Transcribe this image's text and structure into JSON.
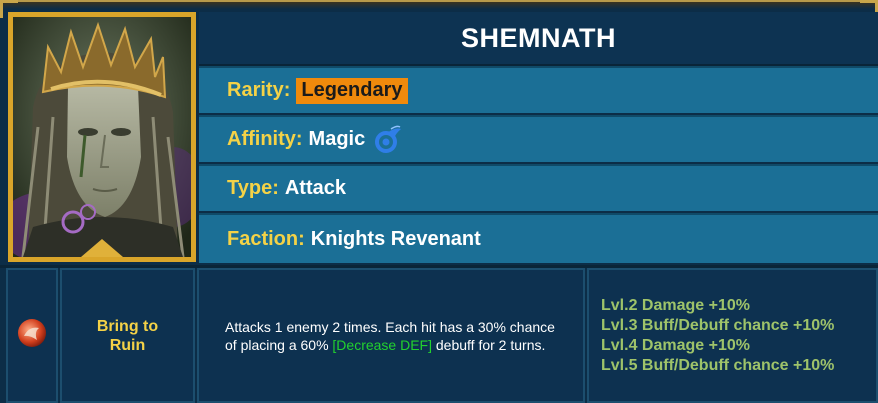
{
  "champion": {
    "name": "SHEMNATH",
    "rarity_label": "Rarity:",
    "rarity": "Legendary",
    "affinity_label": "Affinity:",
    "affinity": "Magic",
    "affinity_icon": "magic-affinity-icon",
    "type_label": "Type:",
    "type": "Attack",
    "faction_label": "Faction:",
    "faction": "Knights Revenant"
  },
  "skill": {
    "icon": "skill-icon",
    "name": "Bring to Ruin",
    "desc_before": "Attacks 1 enemy 2 times. Each hit has a 30% chance of placing a 60% ",
    "desc_debuff": "[Decrease DEF]",
    "desc_after": " debuff for 2 turns.",
    "books": [
      "Lvl.2 Damage +10%",
      "Lvl.3 Buff/Debuff chance +10%",
      "Lvl.4 Damage +10%",
      "Lvl.5 Buff/Debuff chance +10%"
    ]
  },
  "colors": {
    "rarity_badge": "#f08a0c",
    "label_yellow": "#f4d247",
    "debuff_green": "#22d12e",
    "books_green": "#9ec36a",
    "row_blue": "#1b6f96",
    "frame_gold": "#d9a52a"
  }
}
